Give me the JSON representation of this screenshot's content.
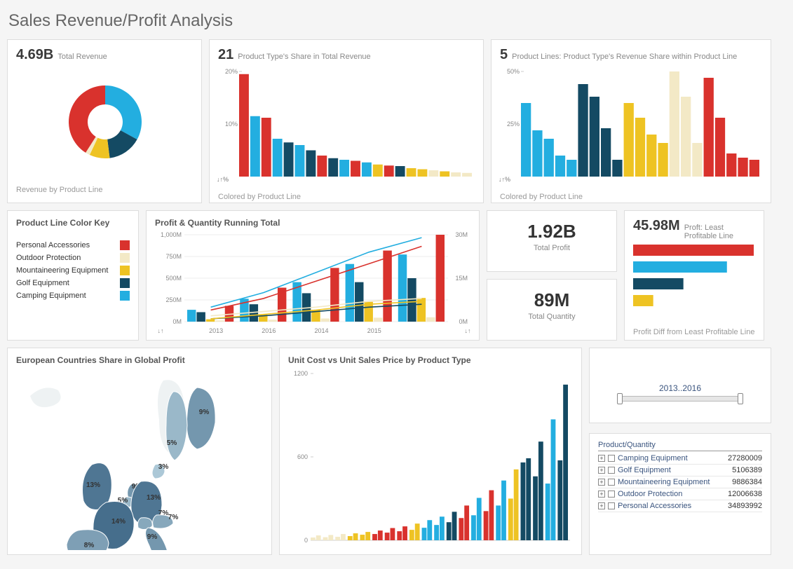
{
  "title": "Sales Revenue/Profit Analysis",
  "colors": {
    "red": "#d9322d",
    "cream": "#f3e9c6",
    "yellow": "#eec323",
    "navy": "#144a63",
    "cyan": "#23aee0"
  },
  "legend": {
    "title": "Product Line Color Key",
    "items": [
      {
        "label": "Personal Accessories",
        "color": "red"
      },
      {
        "label": "Outdoor Protection",
        "color": "cream"
      },
      {
        "label": "Mountaineering Equipment",
        "color": "yellow"
      },
      {
        "label": "Golf Equipment",
        "color": "navy"
      },
      {
        "label": "Camping Equipment",
        "color": "cyan"
      }
    ]
  },
  "card1": {
    "value": "4.69B",
    "label": "Total Revenue",
    "footer": "Revenue by Product Line"
  },
  "card2": {
    "value": "21",
    "label": "Product Type's Share in Total Revenue",
    "footer": "Colored by Product Line"
  },
  "card3": {
    "value": "5",
    "label": "Product Lines: Product Type's Revenue Share within Product Line",
    "footer": "Colored by Product Line"
  },
  "card4": {
    "title": "Profit & Quantity Running Total"
  },
  "card5": {
    "value": "1.92B",
    "label": "Total Profit"
  },
  "card6": {
    "value": "89M",
    "label": "Total Quantity"
  },
  "card7": {
    "value": "45.98M",
    "label": "Proft: Least Profitable Line",
    "footer": "Profit Diff from Least Profitable Line"
  },
  "card8": {
    "title": "European Countries Share in Global Profit"
  },
  "card9": {
    "title": "Unit Cost vs Unit Sales Price by Product Type"
  },
  "slider": {
    "label": "2013..2016"
  },
  "ptable": {
    "header": "Product/Quantity",
    "rows": [
      {
        "label": "Camping Equipment",
        "qty": "27280009"
      },
      {
        "label": "Golf Equipment",
        "qty": "5106389"
      },
      {
        "label": "Mountaineering Equipment",
        "qty": "9886384"
      },
      {
        "label": "Outdoor Protection",
        "qty": "12006638"
      },
      {
        "label": "Personal Accessories",
        "qty": "34893992"
      }
    ]
  },
  "chart_data": [
    {
      "id": "donut_revenue",
      "type": "pie",
      "title": "Revenue by Product Line",
      "series": [
        {
          "name": "Camping Equipment",
          "value": 33,
          "color": "cyan"
        },
        {
          "name": "Golf Equipment",
          "value": 15,
          "color": "navy"
        },
        {
          "name": "Mountaineering Equipment",
          "value": 9,
          "color": "yellow"
        },
        {
          "name": "Outdoor Protection",
          "value": 2,
          "color": "cream"
        },
        {
          "name": "Personal Accessories",
          "value": 41,
          "color": "red"
        }
      ]
    },
    {
      "id": "share_total_revenue",
      "type": "bar",
      "title": "Product Type's Share in Total Revenue",
      "ylabel": "%",
      "ylim": [
        0,
        20
      ],
      "values": [
        {
          "v": 19.5,
          "color": "red"
        },
        {
          "v": 11.5,
          "color": "cyan"
        },
        {
          "v": 11.2,
          "color": "red"
        },
        {
          "v": 7.2,
          "color": "cyan"
        },
        {
          "v": 6.5,
          "color": "navy"
        },
        {
          "v": 6.0,
          "color": "cyan"
        },
        {
          "v": 5.0,
          "color": "navy"
        },
        {
          "v": 4.0,
          "color": "red"
        },
        {
          "v": 3.5,
          "color": "navy"
        },
        {
          "v": 3.2,
          "color": "cyan"
        },
        {
          "v": 3.0,
          "color": "red"
        },
        {
          "v": 2.7,
          "color": "cyan"
        },
        {
          "v": 2.3,
          "color": "yellow"
        },
        {
          "v": 2.1,
          "color": "red"
        },
        {
          "v": 2.0,
          "color": "navy"
        },
        {
          "v": 1.6,
          "color": "yellow"
        },
        {
          "v": 1.4,
          "color": "yellow"
        },
        {
          "v": 1.2,
          "color": "cream"
        },
        {
          "v": 1.0,
          "color": "yellow"
        },
        {
          "v": 0.8,
          "color": "cream"
        },
        {
          "v": 0.7,
          "color": "cream"
        }
      ]
    },
    {
      "id": "share_within_line",
      "type": "bar",
      "title": "Product Type's Revenue Share within Product Line",
      "ylabel": "%",
      "ylim": [
        0,
        50
      ],
      "values": [
        {
          "v": 35,
          "color": "cyan"
        },
        {
          "v": 22,
          "color": "cyan"
        },
        {
          "v": 18,
          "color": "cyan"
        },
        {
          "v": 10,
          "color": "cyan"
        },
        {
          "v": 8,
          "color": "cyan"
        },
        {
          "v": 44,
          "color": "navy"
        },
        {
          "v": 38,
          "color": "navy"
        },
        {
          "v": 23,
          "color": "navy"
        },
        {
          "v": 8,
          "color": "navy"
        },
        {
          "v": 35,
          "color": "yellow"
        },
        {
          "v": 28,
          "color": "yellow"
        },
        {
          "v": 20,
          "color": "yellow"
        },
        {
          "v": 16,
          "color": "yellow"
        },
        {
          "v": 50,
          "color": "cream"
        },
        {
          "v": 38,
          "color": "cream"
        },
        {
          "v": 16,
          "color": "cream"
        },
        {
          "v": 47,
          "color": "red"
        },
        {
          "v": 28,
          "color": "red"
        },
        {
          "v": 11,
          "color": "red"
        },
        {
          "v": 9,
          "color": "red"
        },
        {
          "v": 8,
          "color": "red"
        }
      ]
    },
    {
      "id": "profit_qty_running",
      "type": "bar",
      "title": "Profit & Quantity Running Total",
      "categories": [
        "2013",
        "2016",
        "2014",
        "2015"
      ],
      "y_left": {
        "label": "M",
        "lim": [
          0,
          1000
        ],
        "ticks": [
          0,
          250,
          500,
          750,
          1000
        ]
      },
      "y_right": {
        "label": "M",
        "lim": [
          0,
          30
        ],
        "ticks": [
          0,
          15,
          30
        ]
      },
      "bar_colors": [
        "cyan",
        "navy",
        "yellow",
        "cream",
        "red"
      ],
      "bars": [
        [
          150,
          120,
          30,
          15,
          200
        ],
        [
          290,
          220,
          90,
          25,
          430
        ],
        [
          500,
          360,
          150,
          40,
          680
        ],
        [
          730,
          500,
          250,
          50,
          900
        ],
        [
          850,
          550,
          300,
          55,
          1100
        ]
      ],
      "lines": [
        {
          "color": "cyan",
          "y": [
            5,
            10,
            17,
            24,
            29
          ]
        },
        {
          "color": "navy",
          "y": [
            1,
            2,
            3.5,
            5,
            6
          ]
        },
        {
          "color": "yellow",
          "y": [
            1,
            2.5,
            4,
            6,
            7
          ]
        },
        {
          "color": "cream",
          "y": [
            2,
            3.5,
            5,
            7,
            8
          ]
        },
        {
          "color": "red",
          "y": [
            4,
            8,
            14,
            20,
            26
          ]
        }
      ]
    },
    {
      "id": "profit_diff",
      "type": "bar",
      "title": "Profit Diff from Least Profitable Line",
      "orientation": "horizontal",
      "series": [
        {
          "color": "red",
          "v": 180
        },
        {
          "color": "cyan",
          "v": 140
        },
        {
          "color": "navy",
          "v": 75
        },
        {
          "color": "yellow",
          "v": 30
        }
      ]
    },
    {
      "id": "europe_map",
      "type": "heatmap",
      "title": "European Countries Share in Global Profit",
      "values": [
        {
          "country": "Finland",
          "pct": 9
        },
        {
          "country": "Sweden",
          "pct": 5
        },
        {
          "country": "Denmark",
          "pct": 3
        },
        {
          "country": "UK",
          "pct": 13
        },
        {
          "country": "Netherlands",
          "pct": 9
        },
        {
          "country": "Belgium",
          "pct": 5
        },
        {
          "country": "Germany",
          "pct": 13
        },
        {
          "country": "Switzerland",
          "pct": 7
        },
        {
          "country": "Austria",
          "pct": 7
        },
        {
          "country": "France",
          "pct": 14
        },
        {
          "country": "Italy",
          "pct": 9
        },
        {
          "country": "Spain",
          "pct": 8
        }
      ]
    },
    {
      "id": "unit_cost_vs_price",
      "type": "bar",
      "title": "Unit Cost vs Unit Sales Price by Product Type",
      "ylim": [
        0,
        1200
      ],
      "yticks": [
        0,
        600,
        1200
      ],
      "grouped": true,
      "values": [
        [
          20,
          35
        ],
        [
          22,
          38
        ],
        [
          25,
          45
        ],
        [
          30,
          50
        ],
        [
          40,
          60
        ],
        [
          45,
          70
        ],
        [
          55,
          88
        ],
        [
          65,
          100
        ],
        [
          75,
          120
        ],
        [
          90,
          145
        ],
        [
          110,
          170
        ],
        [
          130,
          205
        ],
        [
          160,
          250
        ],
        [
          180,
          305
        ],
        [
          210,
          360
        ],
        [
          250,
          430
        ],
        [
          300,
          510
        ],
        [
          560,
          590
        ],
        [
          460,
          710
        ],
        [
          408,
          870
        ],
        [
          575,
          1120
        ]
      ],
      "colors": [
        [
          "cream",
          "cream"
        ],
        [
          "cream",
          "cream"
        ],
        [
          "cream",
          "cream"
        ],
        [
          "yellow",
          "yellow"
        ],
        [
          "yellow",
          "yellow"
        ],
        [
          "red",
          "red"
        ],
        [
          "red",
          "red"
        ],
        [
          "red",
          "red"
        ],
        [
          "yellow",
          "yellow"
        ],
        [
          "cyan",
          "cyan"
        ],
        [
          "cyan",
          "cyan"
        ],
        [
          "navy",
          "navy"
        ],
        [
          "red",
          "red"
        ],
        [
          "cyan",
          "cyan"
        ],
        [
          "red",
          "red"
        ],
        [
          "cyan",
          "cyan"
        ],
        [
          "yellow",
          "yellow"
        ],
        [
          "navy",
          "navy"
        ],
        [
          "navy",
          "navy"
        ],
        [
          "cyan",
          "cyan"
        ],
        [
          "navy",
          "navy"
        ]
      ]
    }
  ]
}
